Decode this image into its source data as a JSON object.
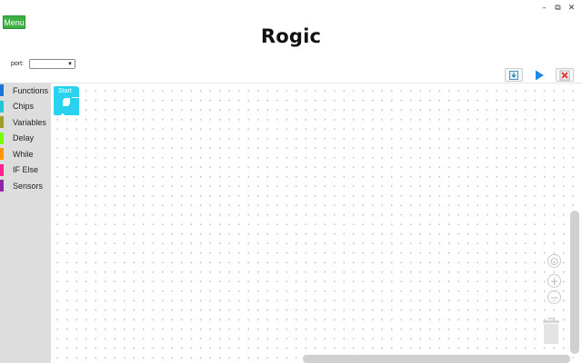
{
  "window": {
    "minimize_glyph": "–",
    "restore_glyph": "⧉",
    "close_glyph": "✕"
  },
  "header": {
    "menu_label": "Menu",
    "title": "Rogic"
  },
  "port": {
    "label": "port:",
    "selected_value": ""
  },
  "toolbar": {
    "download_icon": "download-icon",
    "run_icon": "play-icon",
    "stop_icon": "stop-icon"
  },
  "toolbox": {
    "categories": [
      {
        "label": "Functions",
        "color": "#1976d2"
      },
      {
        "label": "Chips",
        "color": "#26c6da"
      },
      {
        "label": "Variables",
        "color": "#9e9d24"
      },
      {
        "label": "Delay",
        "color": "#76ff03"
      },
      {
        "label": "While",
        "color": "#ff9800"
      },
      {
        "label": "IF Else",
        "color": "#ff1f8f"
      },
      {
        "label": "Sensors",
        "color": "#8e24aa"
      }
    ]
  },
  "workspace": {
    "start_block": {
      "label": "Start",
      "color": "#29d3f0"
    },
    "zoom": {
      "center_glyph": "⊙",
      "in_glyph": "+",
      "out_glyph": "−"
    }
  },
  "colors": {
    "menu_green": "#3cb043",
    "run_blue": "#1e88e5",
    "stop_red": "#e53935"
  }
}
